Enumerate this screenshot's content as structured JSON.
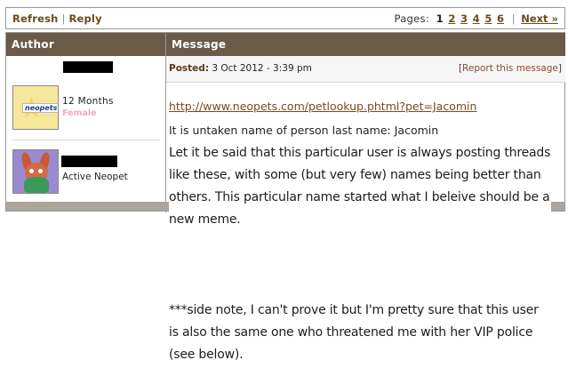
{
  "toolbar": {
    "refresh": "Refresh",
    "separator": "|",
    "reply": "Reply"
  },
  "pagination": {
    "label": "Pages:",
    "pages": [
      "1",
      "2",
      "3",
      "4",
      "5",
      "6"
    ],
    "current": "1",
    "separator": "|",
    "next": "Next »"
  },
  "table": {
    "author_header": "Author",
    "message_header": "Message"
  },
  "author": {
    "account_age": "12 Months",
    "gender": "Female",
    "neopets_badge": "neopets",
    "active_pet_label": "Active Neopet"
  },
  "post": {
    "posted_label": "Posted:",
    "posted_date": "3 Oct 2012 - 3:39 pm",
    "report_open": "[",
    "report_label": "Report this message",
    "report_close": "]",
    "link": "http://www.neopets.com/petlookup.phtml?pet=Jacomin",
    "plain_line": "It is untaken name of person last name: Jacomin",
    "paragraph1": "Let it be said that this particular user is always posting threads like these, with some (but very few) names being better than others. This particular name started what I beleive should be a new meme.",
    "paragraph2": "***side note, I can't prove it but I'm pretty sure that this user is also the same one who threatened me with her VIP police (see below)."
  },
  "colors": {
    "header_bg": "#6b5a48",
    "link": "#7a4a1c",
    "female": "#f0a8c8",
    "bottom_bar": "#aaa49c"
  },
  "icons": {
    "avatar_1": "neopets-star-avatar",
    "avatar_2": "neopet-icon"
  }
}
